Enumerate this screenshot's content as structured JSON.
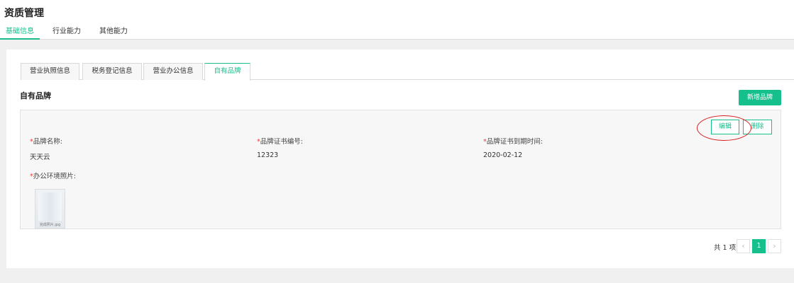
{
  "header": {
    "title": "资质管理",
    "tabs": [
      {
        "label": "基础信息",
        "active": true
      },
      {
        "label": "行业能力",
        "active": false
      },
      {
        "label": "其他能力",
        "active": false
      }
    ]
  },
  "sub_tabs": [
    {
      "label": "营业执照信息",
      "active": false
    },
    {
      "label": "税务登记信息",
      "active": false
    },
    {
      "label": "营业办公信息",
      "active": false
    },
    {
      "label": "自有品牌",
      "active": true
    }
  ],
  "section": {
    "title": "自有品牌",
    "add_button": "新增品牌"
  },
  "brand": {
    "edit_label": "编辑",
    "delete_label": "删除",
    "required_mark": "*",
    "fields": [
      {
        "label": "品牌名称:",
        "value": "天天云"
      },
      {
        "label": "品牌证书编号:",
        "value": "12323"
      },
      {
        "label": "品牌证书到期时间:",
        "value": "2020-02-12"
      }
    ],
    "photo_label": "办公环境照片:",
    "photo_caption": "完成照片.jpg"
  },
  "pagination": {
    "total_text": "共 1 项",
    "prev": "‹",
    "current": "1",
    "next": "›"
  },
  "colors": {
    "accent": "#16c08c",
    "required": "#e0413a",
    "highlight_ellipse": "#d82020"
  }
}
